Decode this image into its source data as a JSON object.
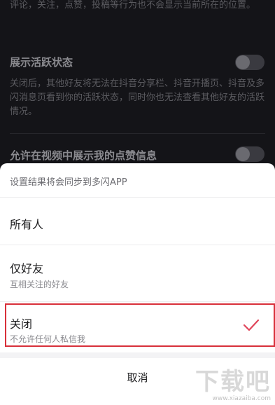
{
  "background": {
    "top_fragment": "评论，关注，点赞，投稿等行为也不会显示当前所在的位置。",
    "active_status": {
      "title": "展示活跃状态",
      "description": "关闭后，其他好友将无法在抖音分享栏、抖音开播页、抖音及多闪消息页看到你的活跃状态，同时你也无法查看其他好友的活跃情况。"
    },
    "likes_info": {
      "title": "允许在视频中展示我的点赞信息"
    }
  },
  "sheet": {
    "hint": "设置结果将会同步到多闪APP",
    "options": [
      {
        "title": "所有人",
        "subtitle": ""
      },
      {
        "title": "仅好友",
        "subtitle": "互相关注的好友"
      },
      {
        "title": "关闭",
        "subtitle": "不允许任何人私信我",
        "selected": true
      }
    ],
    "cancel_label": "取消"
  },
  "watermark": {
    "brand": "下载吧",
    "url": "www.xiazaiba.com"
  },
  "colors": {
    "accent": "#d8303a",
    "check": "#e0455a"
  }
}
